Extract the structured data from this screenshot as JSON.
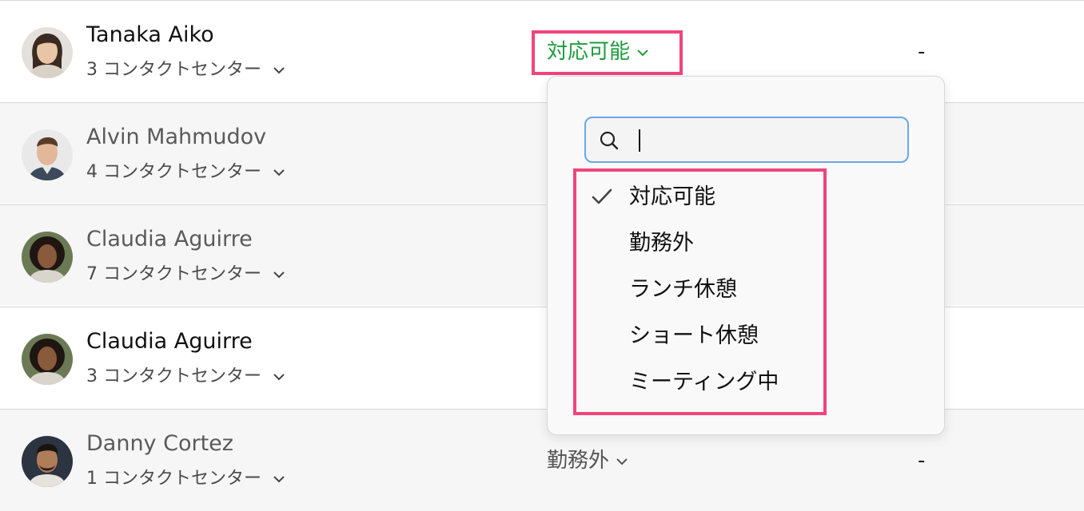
{
  "agents": [
    {
      "name": "Tanaka Aiko",
      "contact_centers": "3 コンタクトセンター",
      "status": "対応可能",
      "extra": "-"
    },
    {
      "name": "Alvin Mahmudov",
      "contact_centers": "4 コンタクトセンター"
    },
    {
      "name": "Claudia Aguirre",
      "contact_centers": "7 コンタクトセンター"
    },
    {
      "name": "Claudia Aguirre",
      "contact_centers": "3 コンタクトセンター"
    },
    {
      "name": "Danny Cortez",
      "contact_centers": "1 コンタクトセンター",
      "status": "勤務外",
      "extra": "-"
    }
  ],
  "status_dropdown": {
    "search_value": "",
    "selected": "対応可能",
    "options": [
      "対応可能",
      "勤務外",
      "ランチ休憩",
      "ショート休憩",
      "ミーティング中"
    ]
  },
  "colors": {
    "available_status": "#1e9c3c",
    "highlight": "#f0457a",
    "search_focus": "#6aa7e8",
    "row_shaded": "#f6f6f6"
  },
  "icons": {
    "chevron": "chevron-down-icon",
    "search": "search-icon",
    "check": "checkmark-icon"
  }
}
